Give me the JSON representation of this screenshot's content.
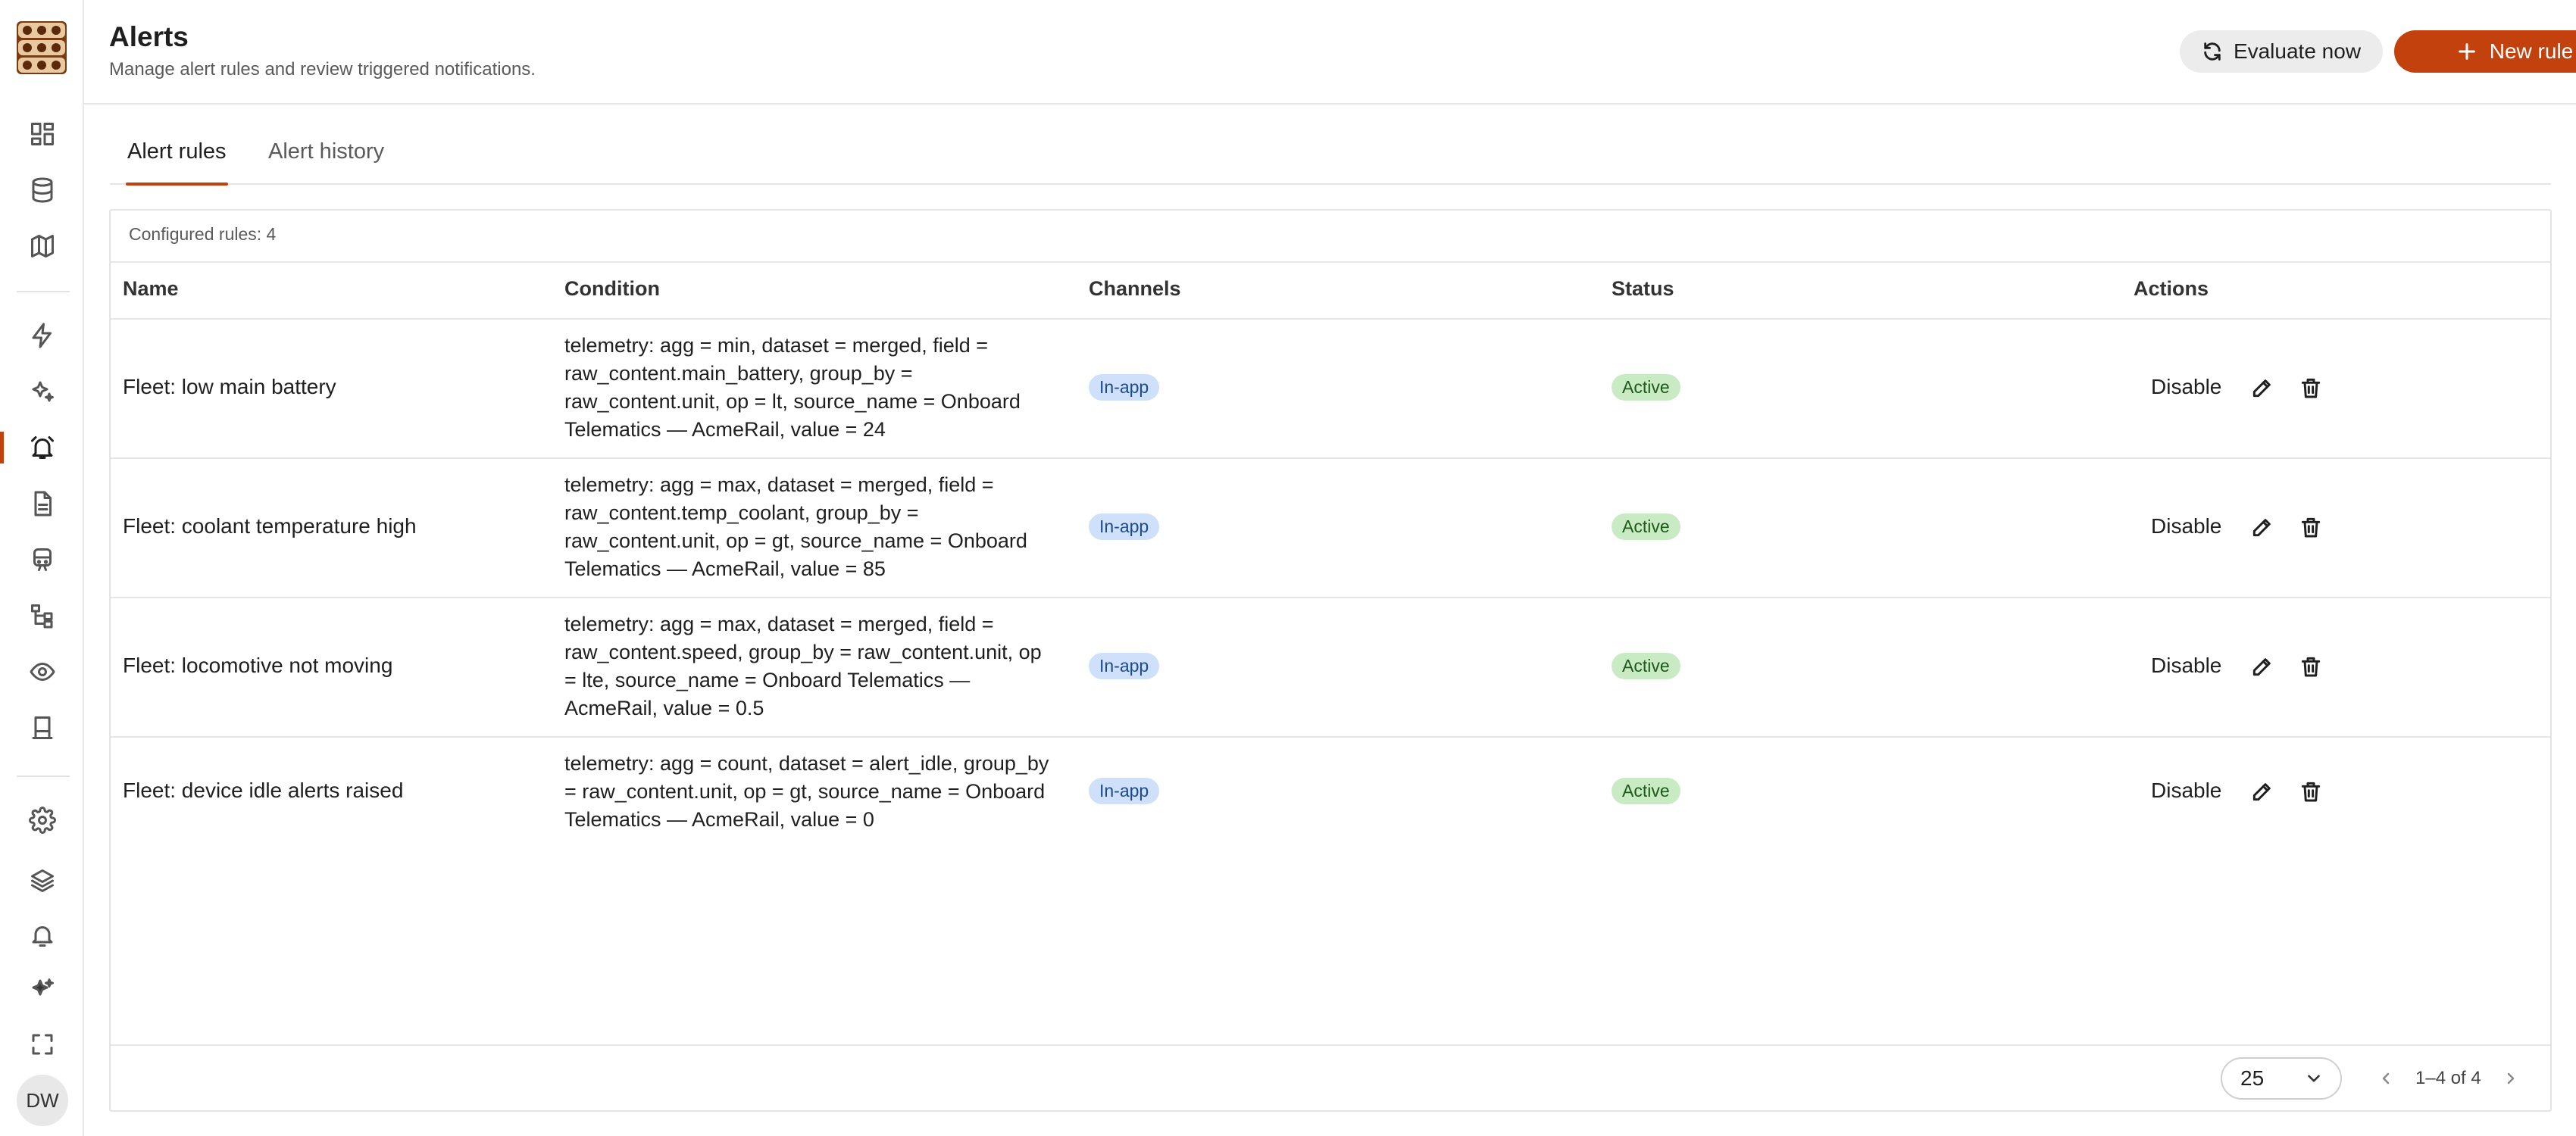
{
  "app": {
    "user_initials": "DW"
  },
  "header": {
    "title": "Alerts",
    "subtitle": "Manage alert rules and review triggered notifications.",
    "evaluate_label": "Evaluate now",
    "new_rule_label": "New rule"
  },
  "tabs": [
    {
      "label": "Alert rules",
      "active": true
    },
    {
      "label": "Alert history",
      "active": false
    }
  ],
  "table": {
    "rule_count": "Configured rules: 4",
    "columns": [
      "Name",
      "Condition",
      "Channels",
      "Status",
      "Actions"
    ],
    "rows": [
      {
        "name": "Fleet: low main battery",
        "condition": "telemetry: agg = min, dataset = merged, field = raw_content.main_battery, group_by = raw_content.unit, op = lt, source_name = Onboard Telematics — AcmeRail, value = 24",
        "channel": "In-app",
        "status": "Active",
        "action": "Disable"
      },
      {
        "name": "Fleet: coolant temperature high",
        "condition": "telemetry: agg = max, dataset = merged, field = raw_content.temp_coolant, group_by = raw_content.unit, op = gt, source_name = Onboard Telematics — AcmeRail, value = 85",
        "channel": "In-app",
        "status": "Active",
        "action": "Disable"
      },
      {
        "name": "Fleet: locomotive not moving",
        "condition": "telemetry: agg = max, dataset = merged, field = raw_content.speed, group_by = raw_content.unit, op = lte, source_name = Onboard Telematics — AcmeRail, value = 0.5",
        "channel": "In-app",
        "status": "Active",
        "action": "Disable"
      },
      {
        "name": "Fleet: device idle alerts raised",
        "condition": "telemetry: agg = count, dataset = alert_idle, group_by = raw_content.unit, op = gt, source_name = Onboard Telematics — AcmeRail, value = 0",
        "channel": "In-app",
        "status": "Active",
        "action": "Disable"
      }
    ]
  },
  "pagination": {
    "page_size": "25",
    "range": "1–4 of 4"
  },
  "colors": {
    "accent": "#c2410c",
    "channel_badge": "#cfe0fa",
    "status_badge": "#c9ebc4"
  },
  "icons": {
    "sidebar": [
      "dashboard-icon",
      "database-icon",
      "map-icon",
      "lightning-icon",
      "sparkles-icon",
      "alarm-icon",
      "document-icon",
      "train-icon",
      "workflow-icon",
      "eye-icon",
      "report-icon",
      "gear-icon",
      "layers-icon",
      "bell-icon",
      "sparkle-icon",
      "fullscreen-icon"
    ]
  }
}
